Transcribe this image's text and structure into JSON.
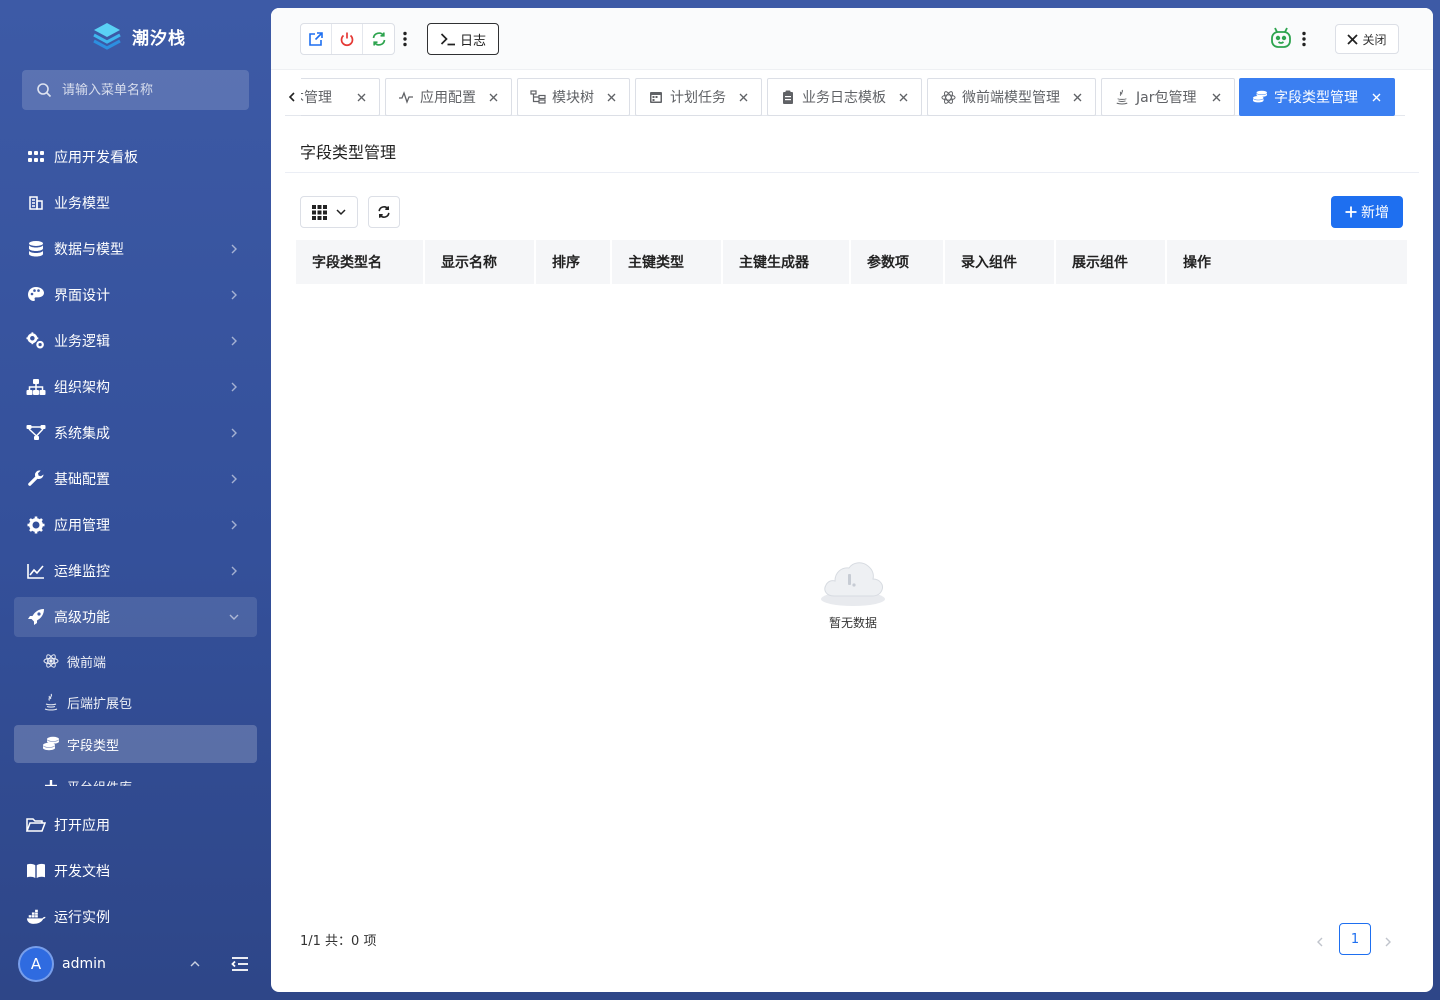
{
  "app": {
    "logo_text": "潮汐栈"
  },
  "sidebar": {
    "search_placeholder": "请输入菜单名称",
    "items": [
      {
        "label": "应用开发看板",
        "icon": "grid-icon"
      },
      {
        "label": "业务模型",
        "icon": "building-icon"
      },
      {
        "label": "数据与模型",
        "icon": "database-icon"
      },
      {
        "label": "界面设计",
        "icon": "palette-icon"
      },
      {
        "label": "业务逻辑",
        "icon": "cogs-icon"
      },
      {
        "label": "组织架构",
        "icon": "org-chart-icon"
      },
      {
        "label": "系统集成",
        "icon": "network-icon"
      },
      {
        "label": "基础配置",
        "icon": "wrench-icon"
      },
      {
        "label": "应用管理",
        "icon": "gear-icon"
      },
      {
        "label": "运维监控",
        "icon": "line-chart-icon"
      },
      {
        "label": "高级功能",
        "icon": "rocket-icon"
      }
    ],
    "sub_items": [
      {
        "label": "微前端",
        "icon": "atom-icon"
      },
      {
        "label": "后端扩展包",
        "icon": "java-icon"
      },
      {
        "label": "字段类型",
        "icon": "coins-icon",
        "active": true
      },
      {
        "label": "平台组件库",
        "icon": "plus-icon"
      }
    ],
    "bottom_items": [
      {
        "label": "打开应用",
        "icon": "folder-open-icon"
      },
      {
        "label": "开发文档",
        "icon": "book-icon"
      },
      {
        "label": "运行实例",
        "icon": "docker-icon"
      }
    ],
    "user": {
      "avatar_letter": "A",
      "name": "admin"
    }
  },
  "topbar": {
    "log_label": "日志",
    "close_label": "关闭"
  },
  "tabs": [
    {
      "label": "本管理",
      "icon": "none"
    },
    {
      "label": "应用配置",
      "icon": "pulse-icon"
    },
    {
      "label": "模块树",
      "icon": "tree-icon"
    },
    {
      "label": "计划任务",
      "icon": "calendar-icon"
    },
    {
      "label": "业务日志模板",
      "icon": "clipboard-icon"
    },
    {
      "label": "微前端模型管理",
      "icon": "atom-icon"
    },
    {
      "label": "Jar包管理",
      "icon": "java-icon"
    },
    {
      "label": "字段类型管理",
      "icon": "coins-icon",
      "active": true
    }
  ],
  "page": {
    "title": "字段类型管理",
    "add_label": "新增",
    "columns": [
      "字段类型名",
      "显示名称",
      "排序",
      "主键类型",
      "主键生成器",
      "参数项",
      "录入组件",
      "展示组件",
      "操作"
    ],
    "rows": [],
    "empty_text": "暂无数据",
    "total_text": "1/1 共：0 项",
    "current_page": "1"
  },
  "colors": {
    "accent": "#1e6ff0",
    "active_tab": "#3b7ff1",
    "sidebar_bg": "#3d5aa6",
    "danger": "#e53935",
    "success": "#2ea44f"
  }
}
